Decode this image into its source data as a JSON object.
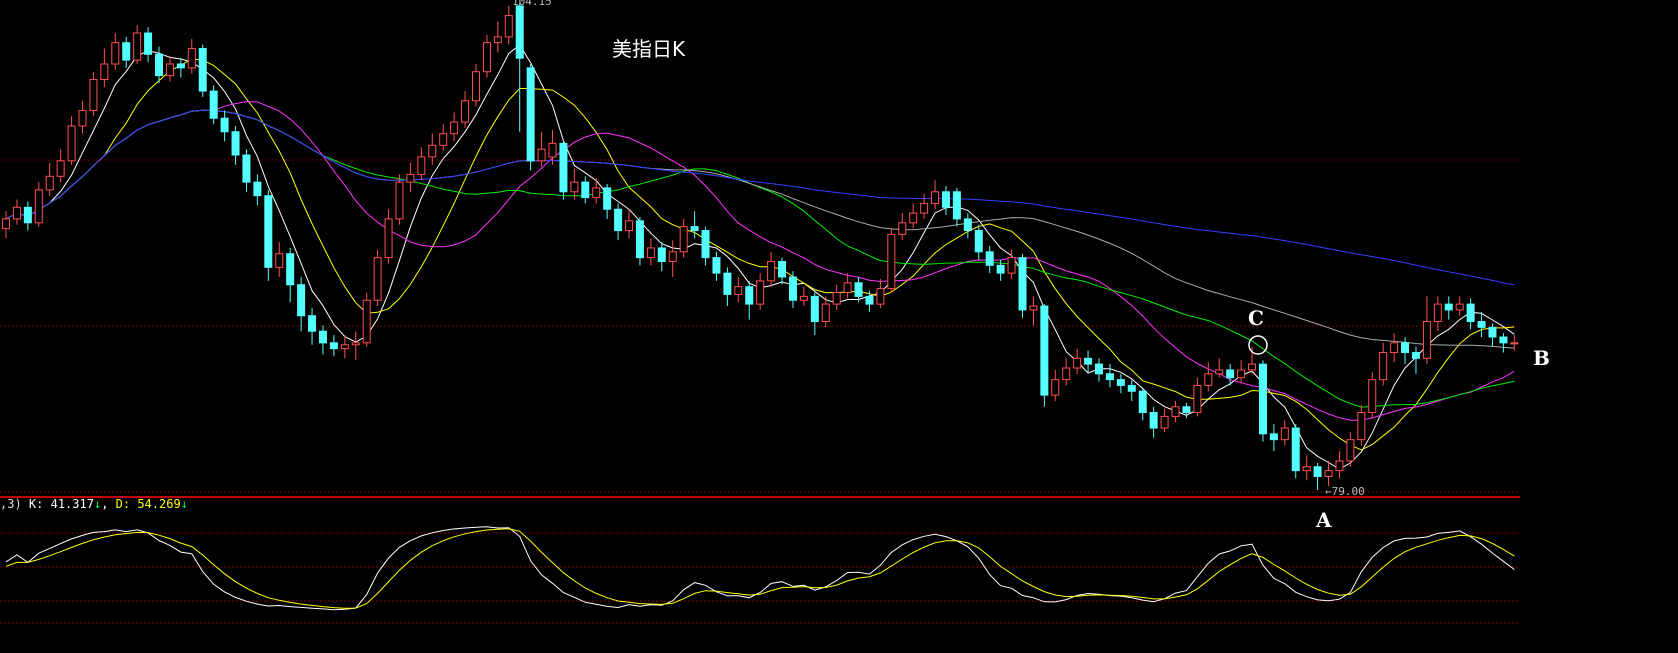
{
  "title": "美指日K",
  "annotations": {
    "a": "A",
    "b": "B",
    "c": "C"
  },
  "high_label": "104.15",
  "low_label": "79.00",
  "low_arrow": "←",
  "kdj": {
    "prefix": ",3)",
    "k_text": "K: 41.317",
    "d_text": "D: 54.269",
    "k_arrow": "↓",
    "d_arrow": "↓",
    "sep": ","
  },
  "colors": {
    "up": "#ff5050",
    "down": "#54ffff",
    "ma5": "#ffffff",
    "ma10": "#ffff00",
    "ma20": "#ff33ff",
    "ma30": "#00ee00",
    "ma60": "#aaaaaa",
    "ma120": "#3040ff",
    "k": "#ffffff",
    "d": "#ffff00",
    "grid": "#7a0000",
    "divider": "#ff0000"
  },
  "chart_data": {
    "type": "candlestick",
    "title": "美指日K",
    "ylim": [
      79.0,
      104.15
    ],
    "ma_periods": [
      5,
      10,
      20,
      30,
      60,
      120
    ],
    "indicator": {
      "name": "KDJ",
      "K": 41.317,
      "D": 54.269,
      "ylim": [
        0,
        100
      ]
    },
    "ohlc": [
      [
        92.5,
        93.4,
        92.0,
        93.0
      ],
      [
        93.0,
        94.0,
        92.7,
        93.6
      ],
      [
        93.6,
        93.9,
        92.4,
        92.8
      ],
      [
        92.8,
        94.9,
        92.6,
        94.5
      ],
      [
        94.5,
        95.9,
        94.2,
        95.2
      ],
      [
        95.2,
        96.6,
        94.9,
        96.0
      ],
      [
        96.0,
        98.3,
        95.8,
        97.8
      ],
      [
        97.8,
        99.1,
        97.4,
        98.6
      ],
      [
        98.6,
        100.6,
        98.3,
        100.2
      ],
      [
        100.2,
        101.8,
        99.8,
        101.0
      ],
      [
        101.0,
        102.6,
        100.7,
        102.1
      ],
      [
        102.1,
        102.4,
        100.8,
        101.2
      ],
      [
        101.2,
        103.0,
        101.0,
        102.6
      ],
      [
        102.6,
        102.9,
        101.1,
        101.5
      ],
      [
        101.5,
        101.9,
        100.0,
        100.4
      ],
      [
        100.4,
        101.4,
        100.1,
        101.0
      ],
      [
        101.0,
        101.3,
        100.3,
        100.8
      ],
      [
        100.8,
        102.3,
        100.5,
        101.8
      ],
      [
        101.8,
        102.0,
        99.3,
        99.6
      ],
      [
        99.6,
        99.9,
        97.9,
        98.2
      ],
      [
        98.2,
        98.6,
        97.0,
        97.5
      ],
      [
        97.5,
        97.8,
        95.8,
        96.3
      ],
      [
        96.3,
        96.6,
        94.4,
        94.9
      ],
      [
        94.9,
        95.3,
        93.7,
        94.2
      ],
      [
        94.2,
        94.5,
        89.8,
        90.5
      ],
      [
        90.5,
        91.8,
        90.0,
        91.2
      ],
      [
        91.2,
        91.5,
        88.7,
        89.6
      ],
      [
        89.6,
        90.0,
        87.2,
        88.0
      ],
      [
        88.0,
        88.4,
        86.5,
        87.2
      ],
      [
        87.2,
        87.5,
        86.0,
        86.6
      ],
      [
        86.6,
        87.0,
        85.9,
        86.3
      ],
      [
        86.3,
        87.0,
        85.8,
        86.5
      ],
      [
        86.5,
        87.2,
        85.7,
        86.6
      ],
      [
        86.6,
        89.2,
        86.4,
        88.8
      ],
      [
        88.8,
        91.4,
        88.5,
        91.0
      ],
      [
        91.0,
        93.5,
        90.7,
        93.0
      ],
      [
        93.0,
        95.3,
        92.7,
        94.9
      ],
      [
        94.9,
        95.9,
        94.4,
        95.3
      ],
      [
        95.3,
        96.7,
        95.0,
        96.2
      ],
      [
        96.2,
        97.4,
        95.8,
        96.8
      ],
      [
        96.8,
        97.9,
        96.5,
        97.4
      ],
      [
        97.4,
        98.5,
        97.0,
        98.0
      ],
      [
        98.0,
        99.6,
        97.7,
        99.1
      ],
      [
        99.1,
        101.0,
        98.8,
        100.6
      ],
      [
        100.6,
        102.5,
        100.3,
        102.1
      ],
      [
        102.1,
        103.2,
        101.6,
        102.4
      ],
      [
        102.4,
        104.0,
        102.0,
        103.5
      ],
      [
        104.0,
        104.15,
        97.5,
        101.3
      ],
      [
        100.8,
        101.0,
        95.5,
        96.0
      ],
      [
        96.0,
        97.5,
        95.7,
        96.6
      ],
      [
        96.2,
        97.6,
        95.8,
        96.9
      ],
      [
        96.9,
        97.0,
        94.0,
        94.4
      ],
      [
        94.4,
        95.6,
        94.0,
        94.9
      ],
      [
        94.9,
        95.2,
        93.8,
        94.1
      ],
      [
        94.1,
        95.1,
        93.8,
        94.6
      ],
      [
        94.6,
        94.8,
        93.0,
        93.5
      ],
      [
        93.5,
        93.8,
        91.9,
        92.4
      ],
      [
        92.4,
        93.5,
        92.0,
        92.9
      ],
      [
        92.9,
        93.1,
        90.6,
        91.0
      ],
      [
        91.0,
        92.0,
        90.6,
        91.5
      ],
      [
        91.5,
        91.8,
        90.3,
        90.8
      ],
      [
        90.8,
        91.9,
        90.0,
        91.3
      ],
      [
        91.3,
        93.0,
        91.0,
        92.6
      ],
      [
        92.6,
        93.4,
        92.0,
        92.4
      ],
      [
        92.4,
        92.6,
        90.6,
        91.0
      ],
      [
        91.0,
        91.3,
        89.8,
        90.2
      ],
      [
        90.2,
        90.5,
        88.5,
        89.1
      ],
      [
        89.1,
        90.0,
        88.7,
        89.5
      ],
      [
        89.5,
        89.8,
        87.8,
        88.6
      ],
      [
        88.6,
        90.2,
        88.3,
        89.8
      ],
      [
        89.8,
        91.3,
        89.5,
        90.8
      ],
      [
        90.8,
        91.0,
        89.6,
        90.0
      ],
      [
        90.0,
        90.3,
        88.4,
        88.8
      ],
      [
        88.8,
        89.5,
        88.5,
        89.0
      ],
      [
        89.0,
        89.2,
        87.0,
        87.7
      ],
      [
        87.7,
        89.0,
        87.4,
        88.6
      ],
      [
        88.6,
        89.6,
        88.3,
        89.2
      ],
      [
        89.2,
        90.2,
        88.9,
        89.7
      ],
      [
        89.7,
        90.0,
        88.7,
        89.0
      ],
      [
        89.0,
        89.3,
        88.2,
        88.6
      ],
      [
        88.6,
        89.9,
        88.4,
        89.4
      ],
      [
        89.4,
        92.5,
        89.2,
        92.2
      ],
      [
        92.2,
        93.3,
        91.9,
        92.8
      ],
      [
        92.8,
        93.8,
        92.5,
        93.3
      ],
      [
        93.3,
        94.3,
        93.0,
        93.8
      ],
      [
        93.8,
        95.0,
        93.5,
        94.4
      ],
      [
        94.4,
        94.7,
        93.2,
        93.6
      ],
      [
        94.4,
        94.6,
        92.6,
        93.0
      ],
      [
        93.0,
        93.3,
        92.0,
        92.4
      ],
      [
        92.4,
        92.7,
        90.9,
        91.3
      ],
      [
        91.3,
        91.6,
        90.2,
        90.6
      ],
      [
        90.6,
        90.9,
        89.8,
        90.2
      ],
      [
        90.2,
        91.4,
        89.9,
        91.0
      ],
      [
        91.0,
        91.2,
        87.9,
        88.3
      ],
      [
        88.3,
        89.0,
        87.5,
        88.5
      ],
      [
        88.5,
        88.6,
        83.3,
        83.9
      ],
      [
        83.9,
        85.2,
        83.6,
        84.7
      ],
      [
        84.7,
        85.8,
        84.4,
        85.3
      ],
      [
        85.3,
        86.3,
        85.0,
        85.8
      ],
      [
        85.8,
        86.2,
        85.1,
        85.5
      ],
      [
        85.5,
        85.8,
        84.6,
        85.0
      ],
      [
        85.0,
        85.5,
        84.3,
        84.7
      ],
      [
        84.7,
        85.0,
        84.0,
        84.4
      ],
      [
        84.4,
        84.7,
        83.6,
        84.1
      ],
      [
        84.1,
        84.3,
        82.6,
        83.0
      ],
      [
        83.0,
        83.3,
        81.7,
        82.2
      ],
      [
        82.2,
        83.2,
        82.0,
        82.8
      ],
      [
        82.8,
        83.6,
        82.5,
        83.3
      ],
      [
        83.3,
        83.5,
        82.7,
        83.0
      ],
      [
        83.0,
        84.8,
        82.8,
        84.4
      ],
      [
        84.4,
        85.6,
        84.1,
        85.0
      ],
      [
        85.0,
        85.8,
        84.8,
        85.2
      ],
      [
        85.2,
        85.5,
        84.4,
        84.8
      ],
      [
        84.8,
        85.7,
        84.5,
        85.2
      ],
      [
        85.2,
        86.4,
        85.0,
        85.5
      ],
      [
        85.5,
        85.7,
        81.5,
        81.9
      ],
      [
        81.9,
        82.4,
        81.0,
        81.6
      ],
      [
        81.6,
        82.6,
        81.3,
        82.2
      ],
      [
        82.2,
        82.4,
        79.6,
        80.0
      ],
      [
        80.0,
        80.8,
        79.5,
        80.2
      ],
      [
        80.2,
        80.4,
        79.0,
        79.7
      ],
      [
        79.7,
        80.5,
        79.2,
        80.0
      ],
      [
        80.0,
        81.0,
        79.6,
        80.5
      ],
      [
        80.5,
        82.0,
        80.2,
        81.6
      ],
      [
        81.6,
        83.4,
        81.3,
        83.0
      ],
      [
        83.0,
        85.1,
        82.7,
        84.7
      ],
      [
        84.7,
        86.6,
        84.4,
        86.1
      ],
      [
        86.1,
        87.1,
        85.6,
        86.6
      ],
      [
        86.6,
        86.9,
        85.5,
        86.1
      ],
      [
        86.1,
        86.4,
        85.0,
        85.8
      ],
      [
        85.8,
        89.0,
        85.5,
        87.7
      ],
      [
        87.7,
        89.0,
        87.2,
        88.6
      ],
      [
        88.6,
        89.0,
        87.8,
        88.3
      ],
      [
        88.3,
        89.0,
        88.0,
        88.6
      ],
      [
        88.6,
        88.9,
        87.3,
        87.7
      ],
      [
        87.7,
        88.2,
        86.9,
        87.4
      ],
      [
        87.4,
        87.6,
        86.4,
        86.9
      ],
      [
        86.9,
        87.1,
        86.1,
        86.6
      ],
      [
        86.6,
        87.0,
        86.2,
        86.6
      ]
    ]
  }
}
